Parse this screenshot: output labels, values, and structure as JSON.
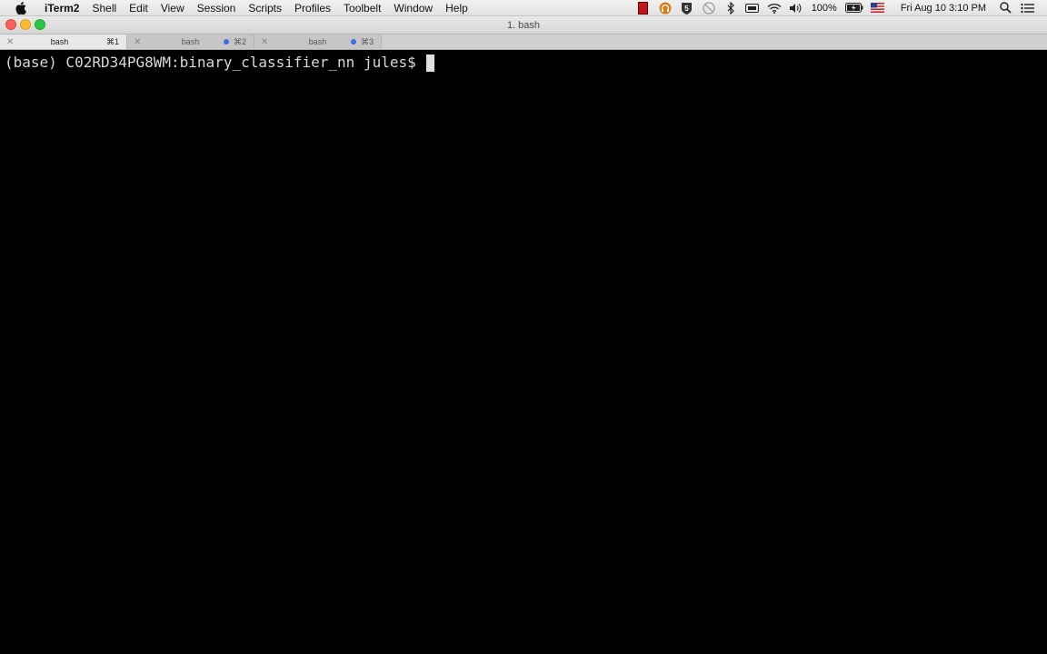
{
  "menubar": {
    "app_name": "iTerm2",
    "items": [
      "Shell",
      "Edit",
      "View",
      "Session",
      "Scripts",
      "Profiles",
      "Toolbelt",
      "Window",
      "Help"
    ],
    "status": {
      "battery": "100%",
      "datetime": "Fri Aug 10  3:10 PM"
    }
  },
  "window": {
    "title": "1. bash"
  },
  "tabs": [
    {
      "label": "bash",
      "shortcut": "⌘1",
      "active": true,
      "activity": false
    },
    {
      "label": "bash",
      "shortcut": "⌘2",
      "active": false,
      "activity": true
    },
    {
      "label": "bash",
      "shortcut": "⌘3",
      "active": false,
      "activity": true
    }
  ],
  "terminal": {
    "prompt": "(base) C02RD34PG8WM:binary_classifier_nn jules$ "
  },
  "colors": {
    "terminal_bg": "#000000",
    "terminal_fg": "#d8d8d8",
    "activity_dot": "#3b6ee8"
  }
}
